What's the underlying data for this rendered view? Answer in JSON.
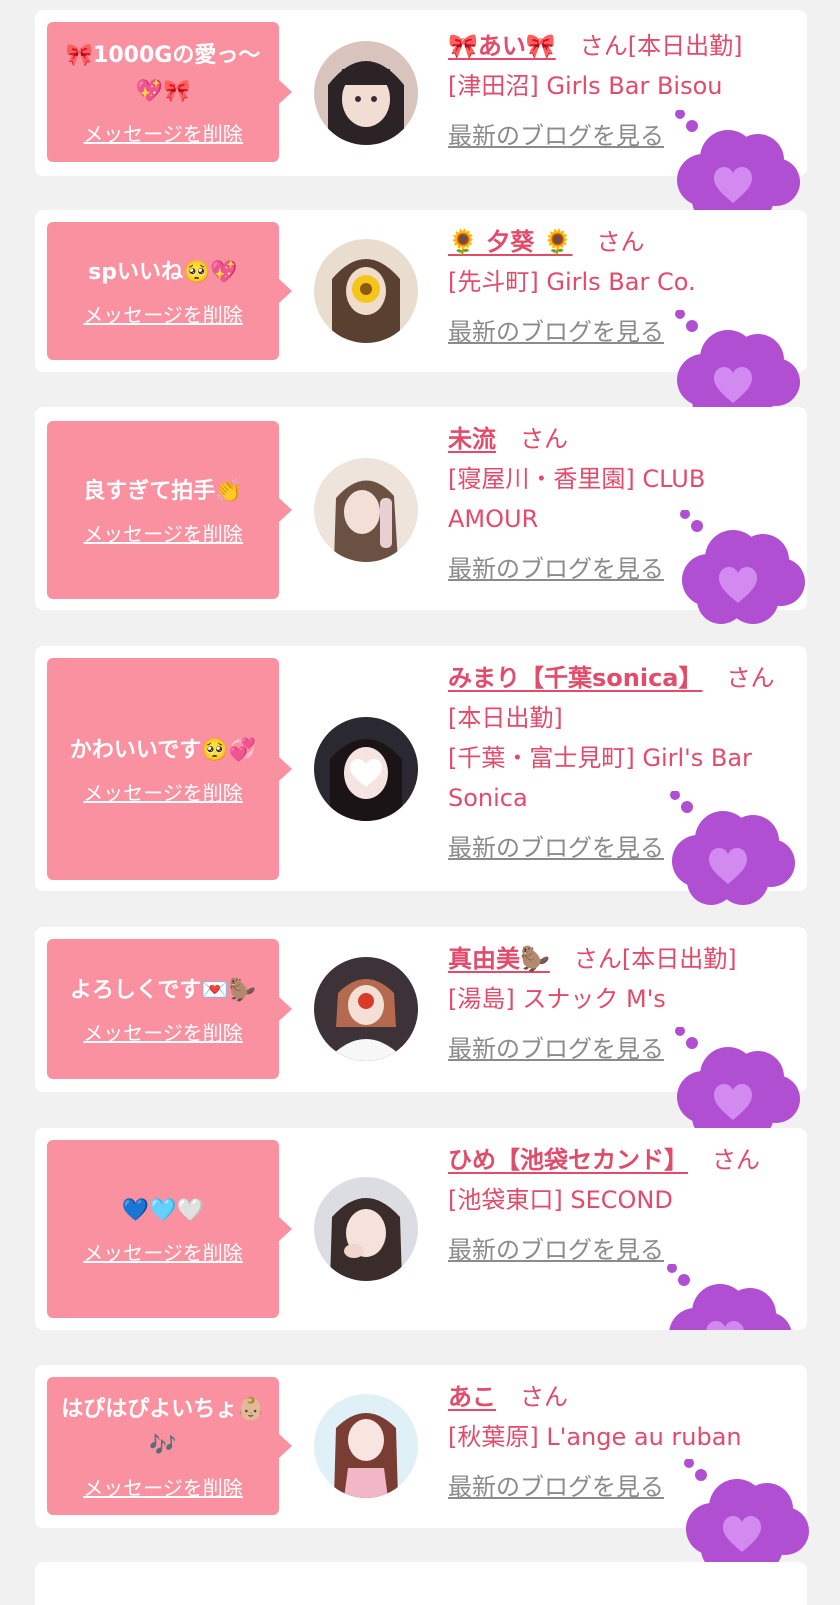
{
  "colors": {
    "page_bg": "#f1f1f1",
    "card_bg": "#ffffff",
    "bubble_bg": "#f991a0",
    "name_text": "#e24b6a",
    "blog_link": "#8b8b8b",
    "cloud": "#b04fd2"
  },
  "delete_label": "メッセージを削除",
  "blog_label": "最新のブログを見る",
  "san_label": "さん",
  "cloud_icon": "purple-heart-icon",
  "items": [
    {
      "message": "🎀1000Gの愛っ〜💖🎀",
      "name": "🎀あい🎀",
      "status": "[本日出勤]",
      "shop": "[津田沼] Girls Bar Bisou"
    },
    {
      "message": "spいいね🥺💖",
      "name": "🌻 夕葵 🌻",
      "status": "",
      "shop": "[先斗町] Girls Bar Co."
    },
    {
      "message": "良すぎて拍手👏",
      "name": "未流",
      "status": "",
      "shop": "[寝屋川・香里園] CLUB AMOUR"
    },
    {
      "message": "かわいいです🥺💞",
      "name": "みまり【千葉sonica】",
      "status": "[本日出勤]",
      "shop": "[千葉・富士見町] Girl's Bar Sonica"
    },
    {
      "message": "よろしくです💌🦫",
      "name": "真由美🦫",
      "status": "[本日出勤]",
      "shop": "[湯島] スナック M's"
    },
    {
      "message": "💙🩵🤍",
      "name": "ひめ【池袋セカンド】",
      "status": "",
      "shop": "[池袋東口] SECOND"
    },
    {
      "message": "はぴはぴよいちょ👶🏼🎶",
      "name": "あこ",
      "status": "",
      "shop": "[秋葉原] L'ange au ruban"
    }
  ]
}
